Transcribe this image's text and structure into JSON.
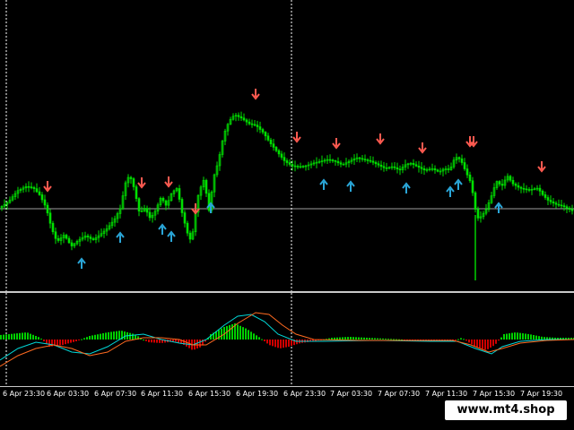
{
  "chart": {
    "background": "#000000",
    "candle_color": "#00e000",
    "price_line_color": "#9e9e9e",
    "separator_color": "#c8c8c8",
    "time_ticks": [
      "6 Apr 23:30",
      "6 Apr 03:30",
      "6 Apr 07:30",
      "6 Apr 11:30",
      "6 Apr 15:30",
      "6 Apr 19:30",
      "6 Apr 23:30",
      "7 Apr 03:30",
      "7 Apr 07:30",
      "7 Apr 11:30",
      "7 Apr 15:30",
      "7 Apr 19:30"
    ],
    "period_separators": [
      "6 Apr 23:30",
      "6 Apr 23:30"
    ]
  },
  "arrows": {
    "sell_color": "#ff5a50",
    "buy_color": "#2aa6d8",
    "sell_label": "sell signal",
    "buy_label": "buy signal"
  },
  "macd": {
    "up_color": "#00d000",
    "down_color": "#d00000",
    "signal_color": "#00d8d8",
    "main_color": "#ff6a20"
  },
  "watermark": {
    "text": "www.mt4.shop"
  }
}
